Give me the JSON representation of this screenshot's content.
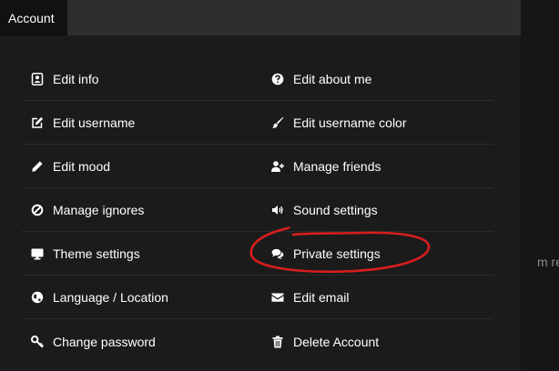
{
  "tabs": [
    {
      "label": "Account",
      "active": true
    }
  ],
  "menu": {
    "left": [
      {
        "label": "Edit info",
        "icon": "contact-card-icon"
      },
      {
        "label": "Edit username",
        "icon": "edit-square-icon"
      },
      {
        "label": "Edit mood",
        "icon": "pencil-icon"
      },
      {
        "label": "Manage ignores",
        "icon": "ban-icon"
      },
      {
        "label": "Theme settings",
        "icon": "monitor-icon"
      },
      {
        "label": "Language / Location",
        "icon": "globe-icon"
      },
      {
        "label": "Change password",
        "icon": "key-icon"
      }
    ],
    "right": [
      {
        "label": "Edit about me",
        "icon": "question-circle-icon"
      },
      {
        "label": "Edit username color",
        "icon": "paintbrush-icon"
      },
      {
        "label": "Manage friends",
        "icon": "user-plus-icon"
      },
      {
        "label": "Sound settings",
        "icon": "volume-icon"
      },
      {
        "label": "Private settings",
        "icon": "chat-bubbles-icon"
      },
      {
        "label": "Edit email",
        "icon": "envelope-icon"
      },
      {
        "label": "Delete Account",
        "icon": "trash-icon"
      }
    ]
  },
  "background_text": "m real,",
  "annotation": {
    "shape": "hand-drawn circle",
    "target": "Private settings",
    "color": "#d81e1e"
  },
  "colors": {
    "panel": "#1b1b1b",
    "tab_bar": "#2e2e2e",
    "active_tab": "#111111",
    "divider": "#2b2b2b",
    "text": "#ffffff",
    "annotation": "#d81e1e"
  }
}
